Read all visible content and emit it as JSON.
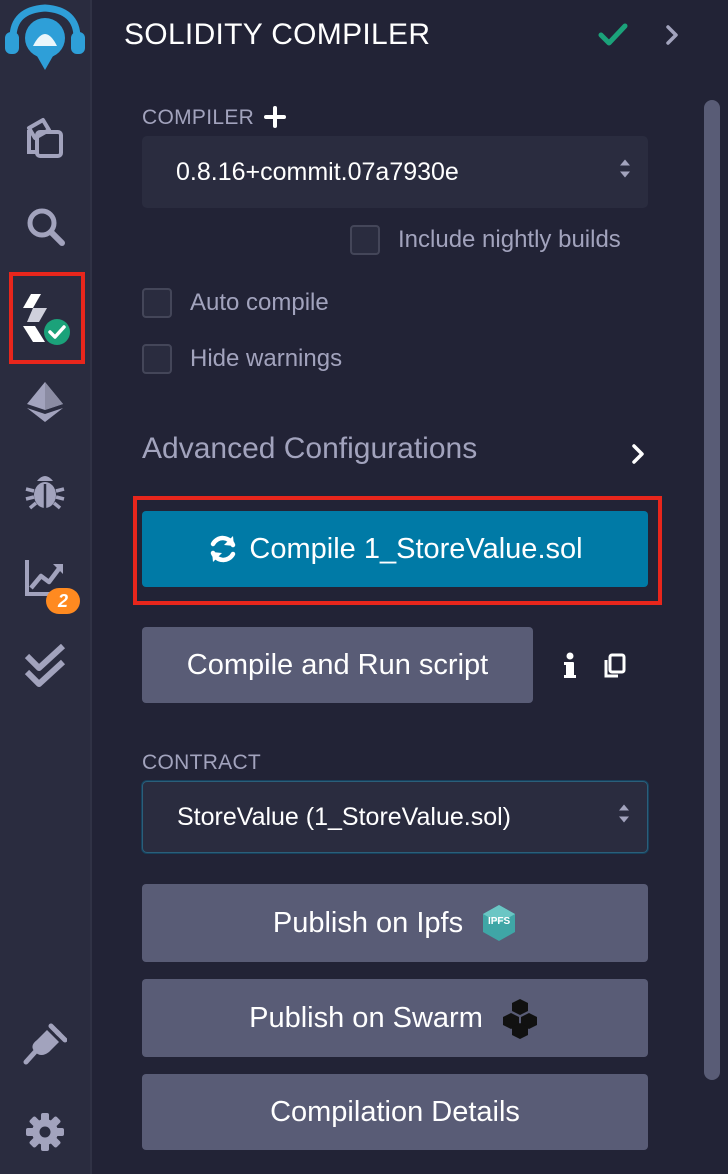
{
  "panel": {
    "title": "SOLIDITY COMPILER"
  },
  "compiler": {
    "label": "COMPILER",
    "version": "0.8.16+commit.07a7930e",
    "nightly_label": "Include nightly builds",
    "nightly_checked": false
  },
  "options": {
    "auto_compile_label": "Auto compile",
    "auto_compile_checked": false,
    "hide_warnings_label": "Hide warnings",
    "hide_warnings_checked": false
  },
  "advanced": {
    "label": "Advanced Configurations"
  },
  "buttons": {
    "compile_label": "Compile 1_StoreValue.sol",
    "compile_run_label": "Compile and Run script",
    "publish_ipfs_label": "Publish on Ipfs",
    "publish_swarm_label": "Publish on Swarm",
    "details_label": "Compilation Details",
    "ipfs_badge_text": "IPFS"
  },
  "contract": {
    "label": "CONTRACT",
    "selected": "StoreValue (1_StoreValue.sol)"
  },
  "iconbar": {
    "items": [
      {
        "icon": "remix-logo-icon"
      },
      {
        "icon": "file-explorer-icon"
      },
      {
        "icon": "search-icon"
      },
      {
        "icon": "solidity-compiler-icon",
        "active": true
      },
      {
        "icon": "deploy-run-icon"
      },
      {
        "icon": "debugger-icon"
      },
      {
        "icon": "analysis-icon",
        "badge": "2"
      },
      {
        "icon": "unit-testing-icon"
      },
      {
        "icon": "plugin-manager-icon"
      },
      {
        "icon": "settings-icon"
      }
    ],
    "analysis_badge": "2"
  },
  "colors": {
    "background": "#222336",
    "sidebar": "#2a2c3f",
    "primary": "#007aa6",
    "secondary": "#595c76",
    "success": "#1ba27a",
    "warning": "#ff8a20",
    "highlight": "#e8261c"
  }
}
